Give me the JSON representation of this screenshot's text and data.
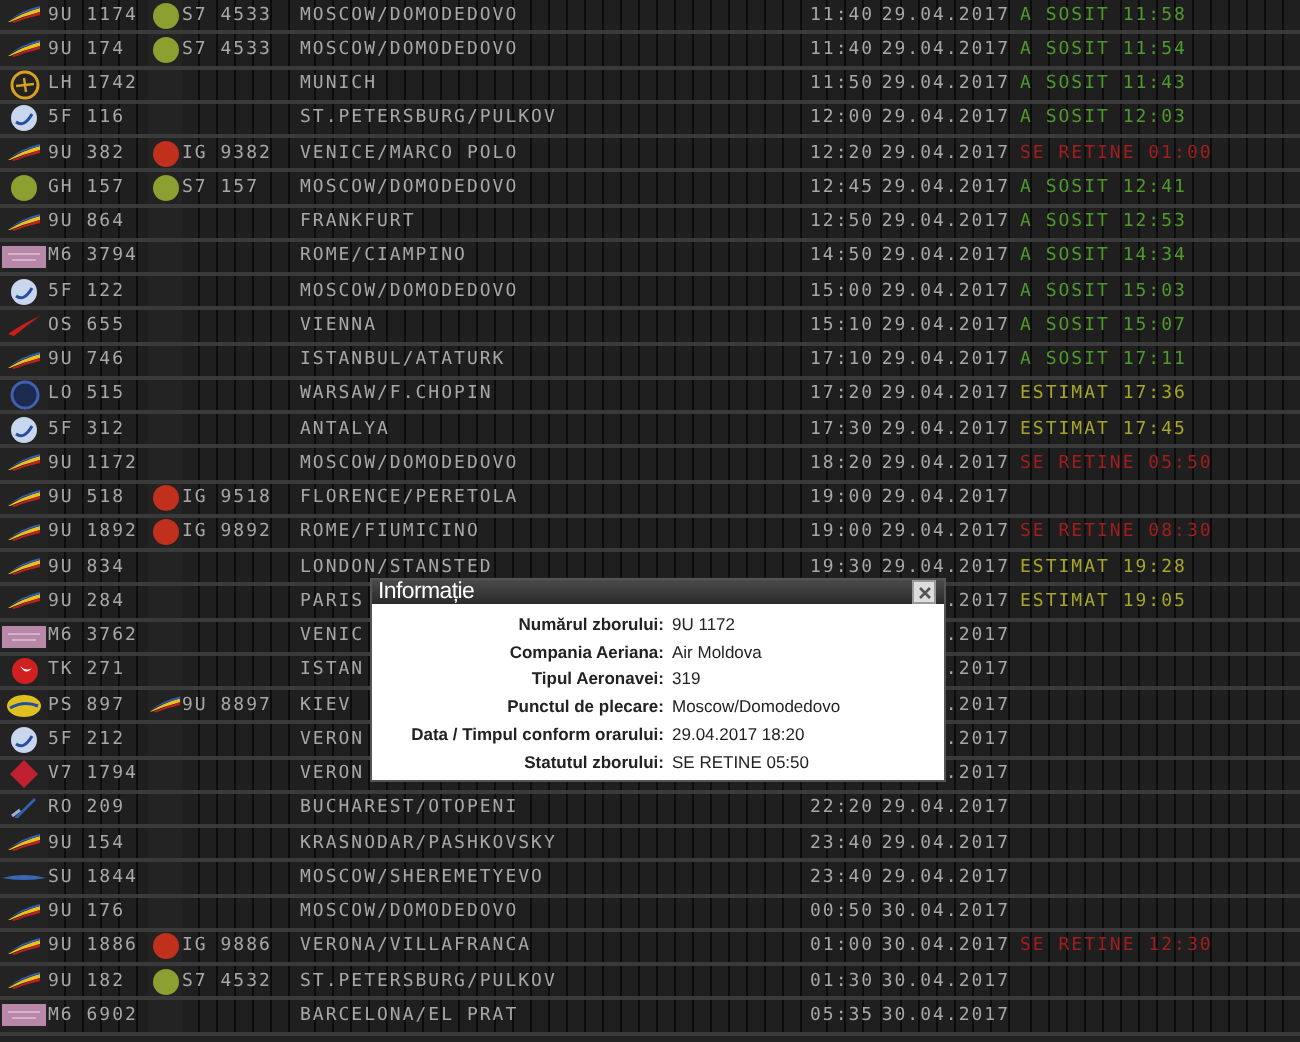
{
  "rows": [
    {
      "logo": {
        "kind": "swoosh"
      },
      "flight": "9U 1174",
      "codeshare": {
        "logo": {
          "kind": "s7"
        },
        "flight": "S7 4533"
      },
      "destination": "MOSCOW/DOMODEDOVO",
      "time": "11:40",
      "date": "29.04.2017",
      "status": {
        "text": "A SOSIT 11:58",
        "kind": "arrived"
      }
    },
    {
      "logo": {
        "kind": "swoosh"
      },
      "flight": "9U 174",
      "codeshare": {
        "logo": {
          "kind": "s7"
        },
        "flight": "S7 4533"
      },
      "destination": "MOSCOW/DOMODEDOVO",
      "time": "11:40",
      "date": "29.04.2017",
      "status": {
        "text": "A SOSIT 11:54",
        "kind": "arrived"
      }
    },
    {
      "logo": {
        "kind": "lufthansa"
      },
      "flight": "LH 1742",
      "destination": "MUNICH",
      "time": "11:50",
      "date": "29.04.2017",
      "status": {
        "text": "A SOSIT 11:43",
        "kind": "arrived"
      }
    },
    {
      "logo": {
        "kind": "rossiya"
      },
      "flight": "5F 116",
      "destination": "ST.PETERSBURG/PULKOV",
      "time": "12:00",
      "date": "29.04.2017",
      "status": {
        "text": "A SOSIT 12:03",
        "kind": "arrived"
      }
    },
    {
      "logo": {
        "kind": "swoosh"
      },
      "flight": "9U 382",
      "codeshare": {
        "logo": {
          "kind": "reddot"
        },
        "flight": "IG 9382"
      },
      "destination": "VENICE/MARCO POLO",
      "time": "12:20",
      "date": "29.04.2017",
      "status": {
        "text": "SE RETINE 01:00",
        "kind": "delayed"
      }
    },
    {
      "logo": {
        "kind": "s7"
      },
      "flight": "GH 157",
      "codeshare": {
        "logo": {
          "kind": "s7"
        },
        "flight": "S7 157"
      },
      "destination": "MOSCOW/DOMODEDOVO",
      "time": "12:45",
      "date": "29.04.2017",
      "status": {
        "text": "A SOSIT 12:41",
        "kind": "arrived"
      }
    },
    {
      "logo": {
        "kind": "swoosh"
      },
      "flight": "9U 864",
      "destination": "FRANKFURT",
      "time": "12:50",
      "date": "29.04.2017",
      "status": {
        "text": "A SOSIT 12:53",
        "kind": "arrived"
      }
    },
    {
      "logo": {
        "kind": "wizz"
      },
      "flight": "M6 3794",
      "destination": "ROME/CIAMPINO",
      "time": "14:50",
      "date": "29.04.2017",
      "status": {
        "text": "A SOSIT 14:34",
        "kind": "arrived"
      }
    },
    {
      "logo": {
        "kind": "rossiya"
      },
      "flight": "5F 122",
      "destination": "MOSCOW/DOMODEDOVO",
      "time": "15:00",
      "date": "29.04.2017",
      "status": {
        "text": "A SOSIT 15:03",
        "kind": "arrived"
      }
    },
    {
      "logo": {
        "kind": "austrian"
      },
      "flight": "OS 655",
      "destination": "VIENNA",
      "time": "15:10",
      "date": "29.04.2017",
      "status": {
        "text": "A SOSIT 15:07",
        "kind": "arrived"
      }
    },
    {
      "logo": {
        "kind": "swoosh"
      },
      "flight": "9U 746",
      "destination": "ISTANBUL/ATATURK",
      "time": "17:10",
      "date": "29.04.2017",
      "status": {
        "text": "A SOSIT 17:11",
        "kind": "arrived"
      }
    },
    {
      "logo": {
        "kind": "lot"
      },
      "flight": "LO 515",
      "destination": "WARSAW/F.CHOPIN",
      "time": "17:20",
      "date": "29.04.2017",
      "status": {
        "text": "ESTIMAT 17:36",
        "kind": "estimated"
      }
    },
    {
      "logo": {
        "kind": "rossiya"
      },
      "flight": "5F 312",
      "destination": "ANTALYA",
      "time": "17:30",
      "date": "29.04.2017",
      "status": {
        "text": "ESTIMAT 17:45",
        "kind": "estimated"
      }
    },
    {
      "logo": {
        "kind": "swoosh"
      },
      "flight": "9U 1172",
      "destination": "MOSCOW/DOMODEDOVO",
      "time": "18:20",
      "date": "29.04.2017",
      "status": {
        "text": "SE RETINE 05:50",
        "kind": "delayed"
      }
    },
    {
      "logo": {
        "kind": "swoosh"
      },
      "flight": "9U 518",
      "codeshare": {
        "logo": {
          "kind": "reddot"
        },
        "flight": "IG 9518"
      },
      "destination": "FLORENCE/PERETOLA",
      "time": "19:00",
      "date": "29.04.2017"
    },
    {
      "logo": {
        "kind": "swoosh"
      },
      "flight": "9U 1892",
      "codeshare": {
        "logo": {
          "kind": "reddot"
        },
        "flight": "IG 9892"
      },
      "destination": "ROME/FIUMICINO",
      "time": "19:00",
      "date": "29.04.2017",
      "status": {
        "text": "SE RETINE 08:30",
        "kind": "delayed"
      }
    },
    {
      "logo": {
        "kind": "swoosh"
      },
      "flight": "9U 834",
      "destination": "LONDON/STANSTED",
      "time": "19:30",
      "date": "29.04.2017",
      "status": {
        "text": "ESTIMAT 19:28",
        "kind": "estimated"
      }
    },
    {
      "logo": {
        "kind": "swoosh"
      },
      "flight": "9U 284",
      "destination": "PARIS",
      "date": ".2017",
      "status": {
        "text": "ESTIMAT 19:05",
        "kind": "estimated"
      }
    },
    {
      "logo": {
        "kind": "wizz"
      },
      "flight": "M6 3762",
      "destination": "VENIC",
      "date": ".2017"
    },
    {
      "logo": {
        "kind": "turkish"
      },
      "flight": "TK 271",
      "destination": "ISTAN",
      "date": ".2017"
    },
    {
      "logo": {
        "kind": "ukraine"
      },
      "flight": "PS 897",
      "codeshare": {
        "logo": {
          "kind": "swoosh"
        },
        "flight": "9U 8897"
      },
      "destination": "KIEV",
      "date": ".2017"
    },
    {
      "logo": {
        "kind": "rossiya"
      },
      "flight": "5F 212",
      "destination": "VERON",
      "date": ".2017"
    },
    {
      "logo": {
        "kind": "diamond"
      },
      "flight": "V7 1794",
      "destination": "VERON",
      "date": ".2017"
    },
    {
      "logo": {
        "kind": "tarom"
      },
      "flight": "RO 209",
      "destination": "BUCHAREST/OTOPENI",
      "time": "22:20",
      "date": "29.04.2017"
    },
    {
      "logo": {
        "kind": "swoosh"
      },
      "flight": "9U 154",
      "destination": "KRASNODAR/PASHKOVSKY",
      "time": "23:40",
      "date": "29.04.2017"
    },
    {
      "logo": {
        "kind": "aeroflot"
      },
      "flight": "SU 1844",
      "destination": "MOSCOW/SHEREMETYEVO",
      "time": "23:40",
      "date": "29.04.2017"
    },
    {
      "logo": {
        "kind": "swoosh"
      },
      "flight": "9U 176",
      "destination": "MOSCOW/DOMODEDOVO",
      "time": "00:50",
      "date": "30.04.2017"
    },
    {
      "logo": {
        "kind": "swoosh"
      },
      "flight": "9U 1886",
      "codeshare": {
        "logo": {
          "kind": "reddot"
        },
        "flight": "IG 9886"
      },
      "destination": "VERONA/VILLAFRANCA",
      "time": "01:00",
      "date": "30.04.2017",
      "status": {
        "text": "SE RETINE 12:30",
        "kind": "delayed"
      }
    },
    {
      "logo": {
        "kind": "swoosh"
      },
      "flight": "9U 182",
      "codeshare": {
        "logo": {
          "kind": "s7"
        },
        "flight": "S7 4532"
      },
      "destination": "ST.PETERSBURG/PULKOV",
      "time": "01:30",
      "date": "30.04.2017"
    },
    {
      "logo": {
        "kind": "wizz"
      },
      "flight": "M6 6902",
      "destination": "BARCELONA/EL PRAT",
      "time": "05:35",
      "date": "30.04.2017"
    }
  ],
  "dialog": {
    "title": "Informație",
    "fields": [
      {
        "label": "Numărul zborului:",
        "value": "9U 1172"
      },
      {
        "label": "Compania Aeriana:",
        "value": "Air Moldova"
      },
      {
        "label": "Tipul Aeronavei:",
        "value": "319"
      },
      {
        "label": "Punctul de plecare:",
        "value": "Moscow/Domodedovo"
      },
      {
        "label": "Data / Timpul conform orarului:",
        "value": "29.04.2017 18:20"
      },
      {
        "label": "Statutul zborului:",
        "value": "SE RETINE 05:50"
      }
    ]
  }
}
